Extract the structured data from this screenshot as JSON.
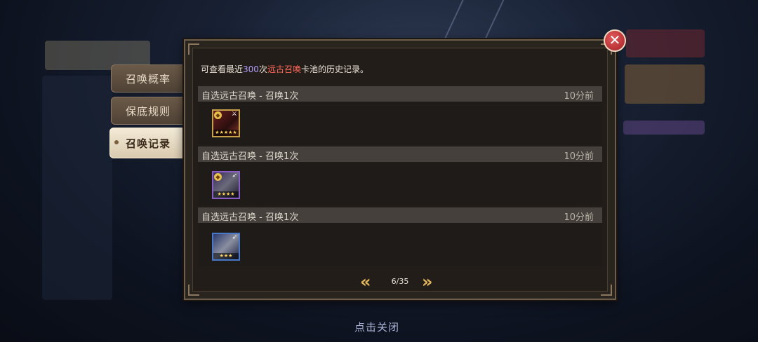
{
  "side_tabs": [
    {
      "label": "召唤概率",
      "active": false
    },
    {
      "label": "保底规则",
      "active": false
    },
    {
      "label": "召唤记录",
      "active": true
    }
  ],
  "intro": {
    "prefix": "可查看最近",
    "count": "300",
    "count_suffix": "次",
    "pool": "远古召唤",
    "suffix": "卡池的历史记录。"
  },
  "records": [
    {
      "title": "自选远古召唤 - 召唤1次",
      "time": "10分前",
      "hero": {
        "element_icon": "fire-element-icon",
        "class_icon": "warrior-class-icon",
        "stars": "★★★★★",
        "border": "#c8a24a"
      }
    },
    {
      "title": "自选远古召唤 - 召唤1次",
      "time": "10分前",
      "hero": {
        "element_icon": "light-element-icon",
        "class_icon": "ranger-class-icon",
        "stars": "★★★★",
        "border": "#8a5cc6"
      }
    },
    {
      "title": "自选远古召唤 - 召唤1次",
      "time": "10分前",
      "hero": {
        "element_icon": "none",
        "class_icon": "ranger-class-icon",
        "stars": "★★★",
        "border": "#4a78c8"
      }
    }
  ],
  "pager": {
    "current": "6",
    "total": "35",
    "label": "6/35",
    "prev_icon": "double-chevron-left-icon",
    "next_icon": "double-chevron-right-icon"
  },
  "close_icon": "close-icon",
  "tap_to_close": "点击关闭",
  "colors": {
    "count_highlight": "#b49cff",
    "pool_highlight": "#ff6a5a",
    "arrow_gold": "#e0b45a"
  }
}
